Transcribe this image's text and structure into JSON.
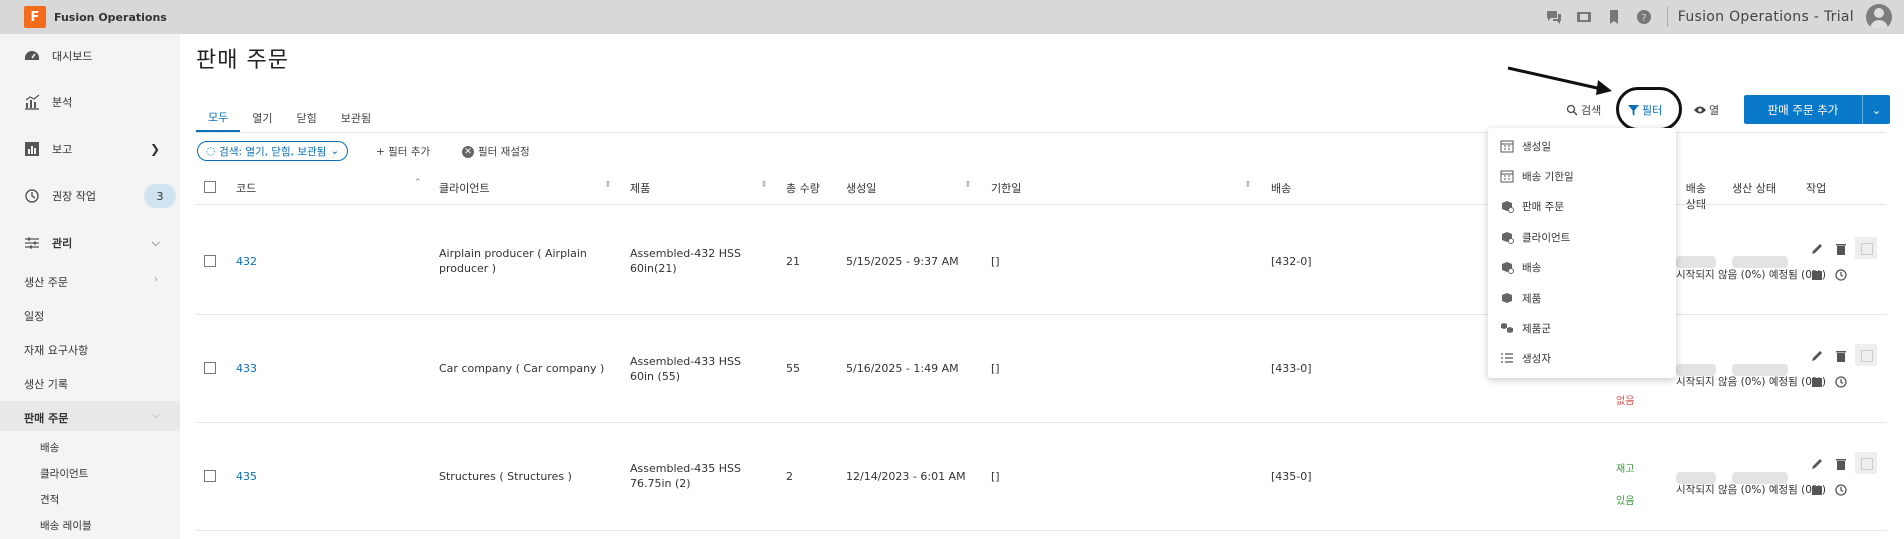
{
  "app": {
    "logo_letter": "F",
    "name": "Fusion Operations",
    "title": "Fusion Operations - Trial"
  },
  "topbar_icons": [
    "chat-icon",
    "film-icon",
    "bookmark-icon",
    "help-icon"
  ],
  "sidebar": {
    "items": [
      {
        "label": "대시보드",
        "icon": "dashboard-icon"
      },
      {
        "label": "분석",
        "icon": "analytics-icon"
      },
      {
        "label": "보고",
        "icon": "report-icon"
      },
      {
        "label": "권장 작업",
        "icon": "history-icon",
        "badge": "3"
      },
      {
        "label": "관리",
        "icon": "sliders-icon"
      }
    ],
    "sub_items": [
      "생산 주문",
      "일정",
      "자재 요구사항",
      "생산 기록",
      "판매 주문"
    ],
    "sales_children": [
      "배송",
      "클라이언트",
      "견적",
      "배송 레이블"
    ]
  },
  "page": {
    "title": "판매 주문"
  },
  "tabs": [
    "모두",
    "열기",
    "닫힘",
    "보관됨"
  ],
  "filter_bar": {
    "chip": "검색: 열기, 닫힘, 보관됨",
    "add": "필터 추가",
    "reset": "필터 재설정"
  },
  "toolbar": {
    "search": "검색",
    "filter": "필터",
    "columns": "열",
    "add_button": "판매 주문 추가"
  },
  "table": {
    "headers": [
      "코드",
      "클라이언트",
      "제품",
      "총 수량",
      "생성일",
      "기한일",
      "배송",
      "배송 상태",
      "생산 상태",
      "작업"
    ],
    "rows": [
      {
        "code": "432",
        "client": "Airplain producer ( Airplain producer )",
        "product": "Assembled-432 HSS 60in(21)",
        "qty": "21",
        "created": "5/15/2025 - 9:37 AM",
        "due": "[]",
        "shipping": "[432-0]",
        "stock1": "",
        "stock2": "",
        "overlay": "시작되지 않음 (0%) 예정됨 (0%)"
      },
      {
        "code": "433",
        "client": "Car company ( Car company )",
        "product": "Assembled-433 HSS 60in (55)",
        "qty": "55",
        "created": "5/16/2025 - 1:49 AM",
        "due": "[]",
        "shipping": "[433-0]",
        "stock1": "",
        "stock2": "없음",
        "overlay": "시작되지 않음 (0%) 예정됨 (0%)"
      },
      {
        "code": "435",
        "client": "Structures ( Structures )",
        "product": "Assembled-435 HSS 76.75in (2)",
        "qty": "2",
        "created": "12/14/2023 - 6:01 AM",
        "due": "[]",
        "shipping": "[435-0]",
        "stock1": "재고",
        "stock2": "있음",
        "overlay": "시작되지 않음 (0%) 예정됨 (0%)"
      }
    ]
  },
  "filter_menu": [
    {
      "label": "생성일",
      "icon": "calendar-icon"
    },
    {
      "label": "배송 기한일",
      "icon": "calendar-icon"
    },
    {
      "label": "판매 주문",
      "icon": "box-icon"
    },
    {
      "label": "클라이언트",
      "icon": "box-icon"
    },
    {
      "label": "배송",
      "icon": "box-icon"
    },
    {
      "label": "제품",
      "icon": "cube-icon"
    },
    {
      "label": "제품군",
      "icon": "cubes-icon"
    },
    {
      "label": "생성자",
      "icon": "list-icon"
    }
  ],
  "colors": {
    "accent": "#0a78c8",
    "link": "#0a6fb5",
    "logo": "#f36c1c",
    "topbar": "#d8d8d8",
    "sidebar": "#f4f4f4"
  }
}
